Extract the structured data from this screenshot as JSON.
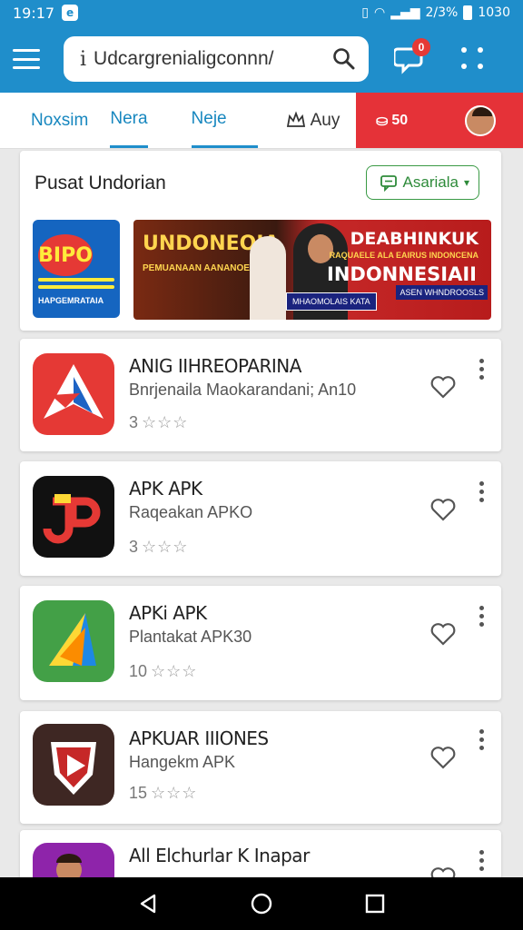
{
  "status_bar": {
    "time": "19:17",
    "right_text": "2/3%",
    "battery_text": "1030"
  },
  "search": {
    "lead_glyph": "i",
    "value": "Udcargrenialigconnn/"
  },
  "header": {
    "badge": "0"
  },
  "tabs": [
    {
      "label": "Noxsim"
    },
    {
      "label": "Nera"
    },
    {
      "label": "Neje"
    },
    {
      "label": "Auy"
    }
  ],
  "promo_tab": {
    "label": "50"
  },
  "section": {
    "title": "Pusat Undorian",
    "pill_label": "Asariala"
  },
  "banner_small": {
    "logo_text": "BIPO",
    "sub_text": "HAPGEMRATAIA"
  },
  "banner_big": {
    "left_title": "UNDONEOIA",
    "left_sub": "PEMUANAAN AANANOEIE",
    "right_title": "DEABHINKUK",
    "right_sub": "RAQUAELE ALA EAIRUS INDONCENA",
    "right_title_2": "INDONNESIAII",
    "tag_1": "MHAOMOLAIS KATA",
    "tag_2": "ASEN WHNDROOSLS"
  },
  "apps": [
    {
      "name": "ANIG IIHREOPARINA",
      "subtitle": "Bnrjenaila Maokarandani; An10",
      "rating": "3",
      "icon_color": "#e53935"
    },
    {
      "name": "APK APK",
      "subtitle": "Raqeakan APKO",
      "rating": "3",
      "icon_color": "#111111"
    },
    {
      "name": "APKi APK",
      "subtitle": "Plantakat APK30",
      "rating": "10",
      "icon_color": "#43a047"
    },
    {
      "name": "APKUAR IIIONES",
      "subtitle": "Hangekm APK",
      "rating": "15",
      "icon_color": "#3e2723"
    },
    {
      "name": "All Elchurlar K Inapar",
      "subtitle": "",
      "rating": "",
      "icon_color": "#8e24aa"
    }
  ],
  "icons": {
    "menu": "menu-icon",
    "search": "search-icon",
    "chat": "chat-icon",
    "apps_grid": "grid-icon",
    "crown": "crown-icon",
    "heart": "heart-icon",
    "more": "more-vert-icon",
    "back": "back-icon",
    "home": "home-icon",
    "recents": "recents-icon"
  },
  "colors": {
    "primary": "#1f8ecb",
    "promo": "#e53238",
    "accent_green": "#3a9a45"
  }
}
